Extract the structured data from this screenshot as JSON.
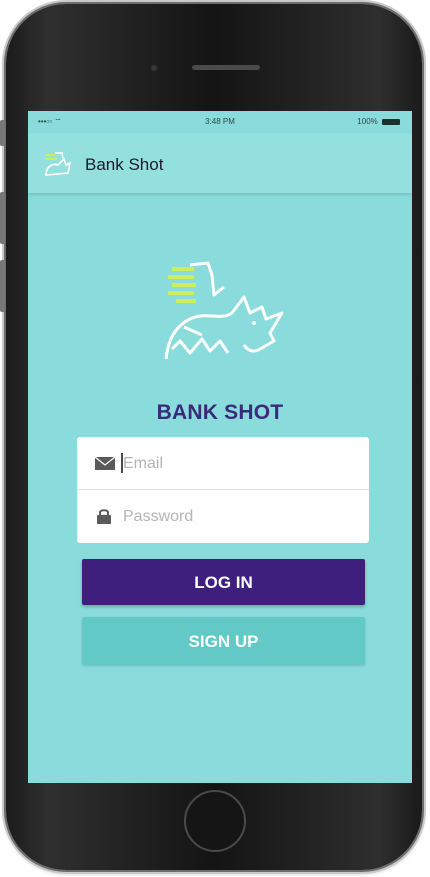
{
  "status_bar": {
    "carrier": "•••• ",
    "time": "3:48 PM",
    "battery_text": "100%"
  },
  "app_bar": {
    "title": "Bank Shot",
    "logo_icon": "rhino-logo-icon"
  },
  "brand": {
    "title": "BANK SHOT"
  },
  "form": {
    "email": {
      "placeholder": "Email",
      "value": "",
      "icon": "envelope-icon"
    },
    "password": {
      "placeholder": "Password",
      "value": "",
      "icon": "lock-icon"
    }
  },
  "buttons": {
    "login_label": "LOG IN",
    "signup_label": "SIGN UP"
  },
  "colors": {
    "background": "#8adbdb",
    "brand_purple": "#3f1f7e",
    "signup_teal": "#62c9c6",
    "logo_green": "#c8f05a"
  }
}
